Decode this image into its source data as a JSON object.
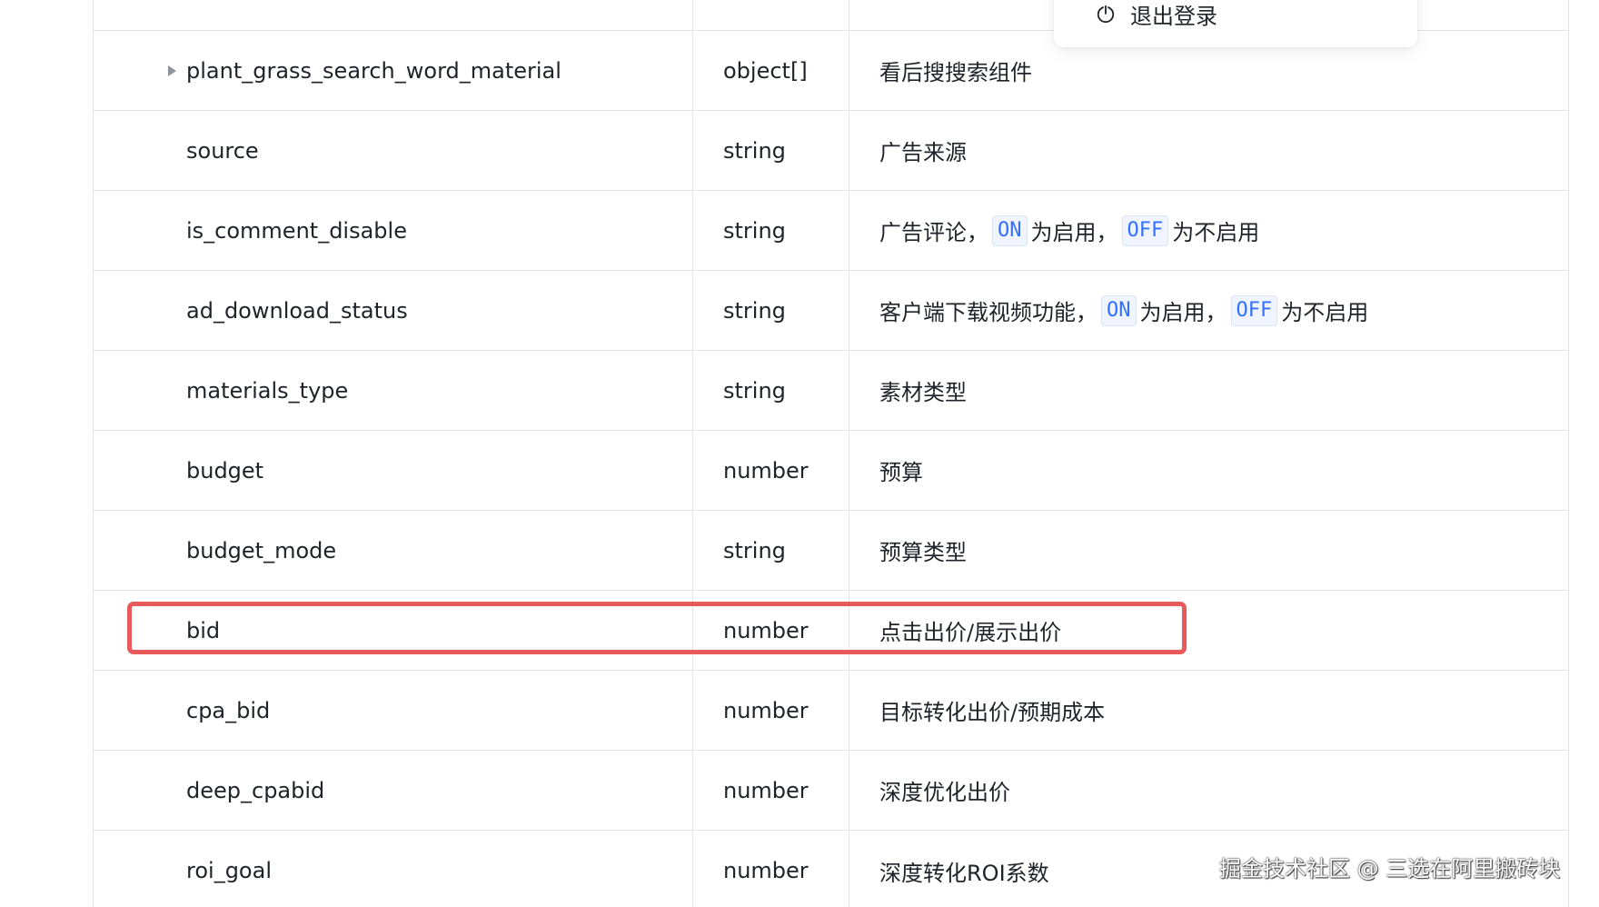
{
  "table": {
    "rows": [
      {
        "name": "",
        "type": "",
        "desc_text": ""
      },
      {
        "name": "plant_grass_search_word_material",
        "type": "object[]",
        "desc_text": "看后搜搜索组件",
        "expandable": true
      },
      {
        "name": "source",
        "type": "string",
        "desc_text": "广告来源"
      },
      {
        "name": "is_comment_disable",
        "type": "string",
        "desc_parts": [
          "广告评论，",
          "ON",
          "为启用，",
          "OFF",
          "为不启用"
        ]
      },
      {
        "name": "ad_download_status",
        "type": "string",
        "desc_parts": [
          "客户端下载视频功能，",
          "ON",
          "为启用，",
          "OFF",
          "为不启用"
        ]
      },
      {
        "name": "materials_type",
        "type": "string",
        "desc_text": "素材类型"
      },
      {
        "name": "budget",
        "type": "number",
        "desc_text": "预算"
      },
      {
        "name": "budget_mode",
        "type": "string",
        "desc_text": "预算类型"
      },
      {
        "name": "bid",
        "type": "number",
        "desc_text": "点击出价/展示出价",
        "highlighted": true
      },
      {
        "name": "cpa_bid",
        "type": "number",
        "desc_text": "目标转化出价/预期成本"
      },
      {
        "name": "deep_cpabid",
        "type": "number",
        "desc_text": "深度优化出价"
      },
      {
        "name": "roi_goal",
        "type": "number",
        "desc_text": "深度转化ROI系数"
      }
    ]
  },
  "popup": {
    "logout_label": "退出登录",
    "icon": "power-icon"
  },
  "watermark": "掘金技术社区 @ 三选在阿里搬砖块",
  "colors": {
    "highlight_border": "#e85a5a",
    "code_tag_text": "#3370ff",
    "grid_line": "#e3e5e8"
  }
}
